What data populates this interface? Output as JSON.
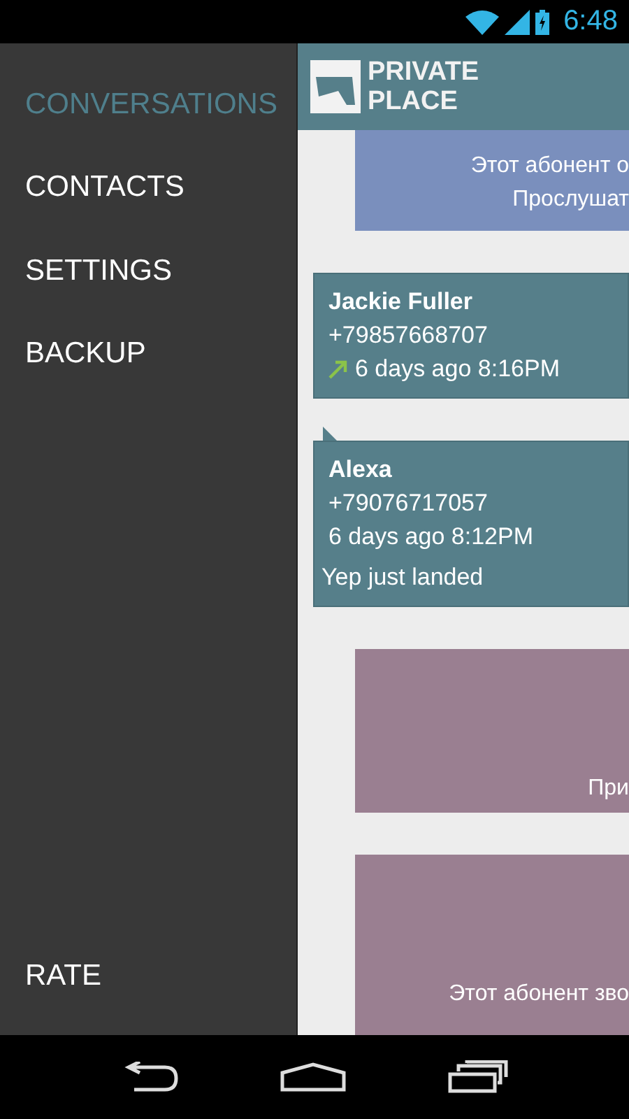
{
  "status_bar": {
    "time": "6:48"
  },
  "drawer": {
    "items": [
      {
        "label": "CONVERSATIONS",
        "selected": true
      },
      {
        "label": "CONTACTS",
        "selected": false
      },
      {
        "label": "SETTINGS",
        "selected": false
      },
      {
        "label": "BACKUP",
        "selected": false
      }
    ],
    "footer_item": "RATE"
  },
  "header": {
    "logo_line_1": "PRIVATE",
    "logo_line_2": "PLACE"
  },
  "cards": [
    {
      "kind": "notice",
      "color": "#7a8fbd",
      "lines": [
        "Этот абонент о",
        "Прослушат"
      ]
    },
    {
      "kind": "contact",
      "name": "Jackie Fuller",
      "phone": "+79857668707",
      "time": "6 days ago 8:16PM",
      "outgoing": true,
      "tail": false
    },
    {
      "kind": "contact",
      "name": "Alexa",
      "phone": "+79076717057",
      "time": "6 days ago 8:12PM",
      "outgoing": false,
      "tail": true,
      "message": "Yep just landed"
    },
    {
      "kind": "notice",
      "color": "#9a7f91",
      "lines": [
        "При"
      ]
    },
    {
      "kind": "notice",
      "color": "#9a7f91",
      "lines": [
        "Этот абонент зво"
      ]
    }
  ]
}
